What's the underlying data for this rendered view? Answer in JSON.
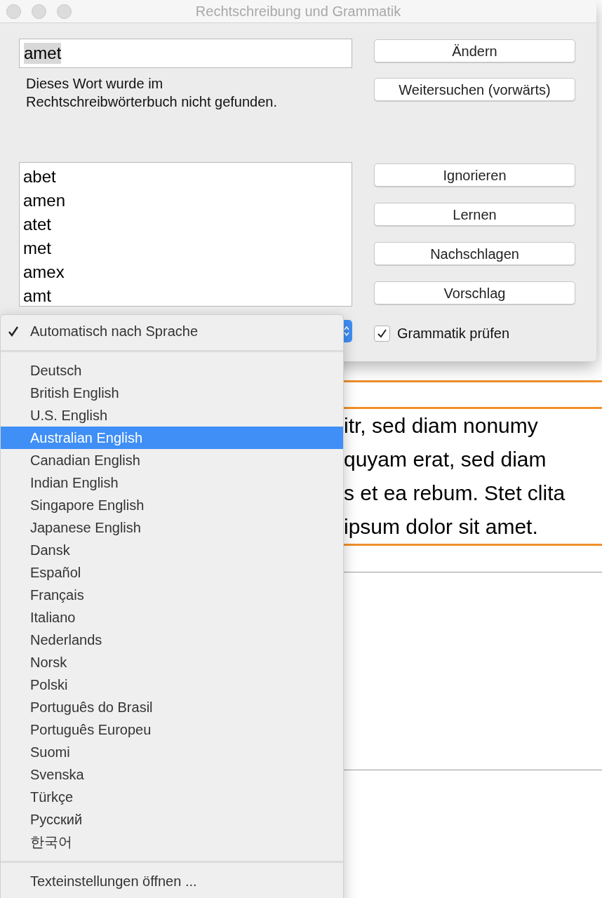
{
  "window": {
    "title": "Rechtschreibung und Grammatik"
  },
  "word_field": {
    "value": "amet",
    "selected": true
  },
  "message": "Dieses Wort wurde im Rechtschreibwörterbuch nicht gefunden.",
  "top_buttons": [
    "Ändern",
    "Weitersuchen (vorwärts)"
  ],
  "suggestions": [
    {
      "text": "abet",
      "selected": false
    },
    {
      "text": "amen",
      "selected": false
    },
    {
      "text": "atet",
      "selected": false
    },
    {
      "text": "met",
      "selected": false
    },
    {
      "text": "amex",
      "selected": false
    },
    {
      "text": "amt",
      "selected": false
    }
  ],
  "side_buttons": [
    "Ignorieren",
    "Lernen",
    "Nachschlagen",
    "Vorschlag"
  ],
  "grammar_check": {
    "label": "Grammatik prüfen",
    "checked": true
  },
  "language_menu": {
    "sections": [
      {
        "items": [
          {
            "label": "Automatisch nach Sprache",
            "checked": true,
            "selected": false
          }
        ]
      },
      {
        "items": [
          {
            "label": "Deutsch",
            "checked": false,
            "selected": false
          },
          {
            "label": "British English",
            "checked": false,
            "selected": false
          },
          {
            "label": "U.S. English",
            "checked": false,
            "selected": false
          },
          {
            "label": "Australian English",
            "checked": false,
            "selected": true
          },
          {
            "label": "Canadian English",
            "checked": false,
            "selected": false
          },
          {
            "label": "Indian English",
            "checked": false,
            "selected": false
          },
          {
            "label": "Singapore English",
            "checked": false,
            "selected": false
          },
          {
            "label": "Japanese English",
            "checked": false,
            "selected": false
          },
          {
            "label": "Dansk",
            "checked": false,
            "selected": false
          },
          {
            "label": "Español",
            "checked": false,
            "selected": false
          },
          {
            "label": "Français",
            "checked": false,
            "selected": false
          },
          {
            "label": "Italiano",
            "checked": false,
            "selected": false
          },
          {
            "label": "Nederlands",
            "checked": false,
            "selected": false
          },
          {
            "label": "Norsk",
            "checked": false,
            "selected": false
          },
          {
            "label": "Polski",
            "checked": false,
            "selected": false
          },
          {
            "label": "Português do Brasil",
            "checked": false,
            "selected": false
          },
          {
            "label": "Português Europeu",
            "checked": false,
            "selected": false
          },
          {
            "label": "Suomi",
            "checked": false,
            "selected": false
          },
          {
            "label": "Svenska",
            "checked": false,
            "selected": false
          },
          {
            "label": "Türkçe",
            "checked": false,
            "selected": false
          },
          {
            "label": "Русский",
            "checked": false,
            "selected": false
          },
          {
            "label": "한국어",
            "checked": false,
            "selected": false
          }
        ]
      },
      {
        "items": [
          {
            "label": "Texteinstellungen öffnen ...",
            "checked": false,
            "selected": false
          }
        ]
      }
    ]
  },
  "document": {
    "lines": [
      "itr, sed diam nonumy",
      "quyam erat, sed diam",
      "s et ea rebum. Stet clita",
      "ipsum dolor sit amet."
    ]
  }
}
